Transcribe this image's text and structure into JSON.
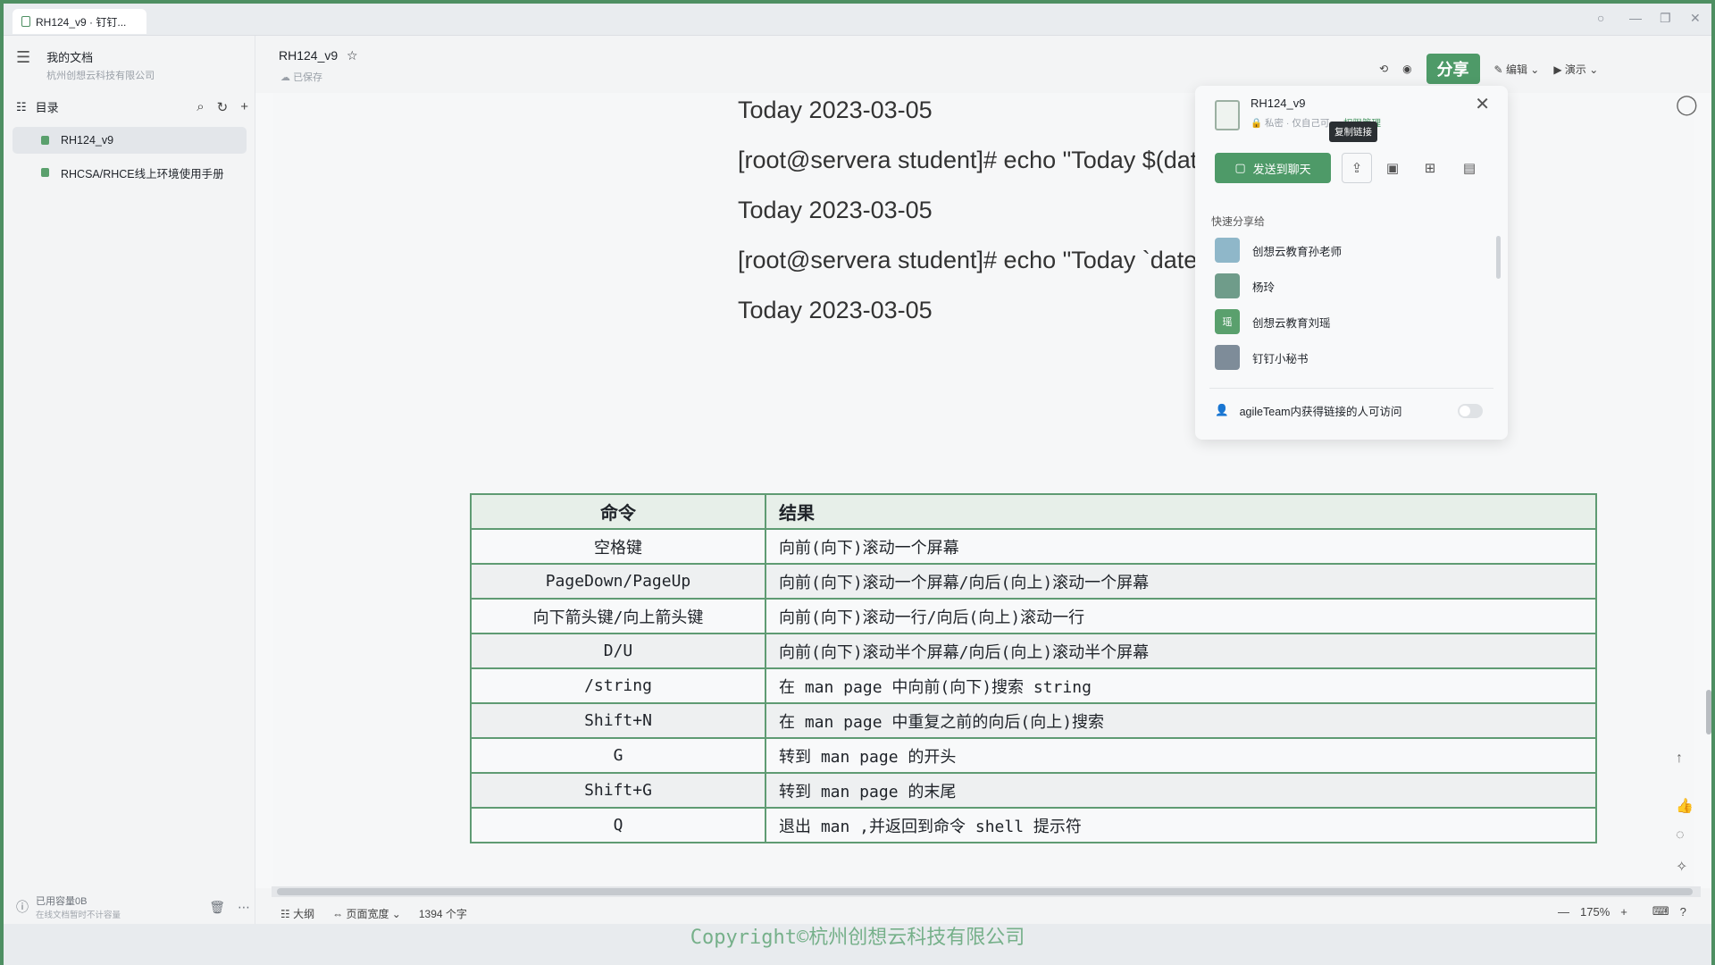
{
  "window": {
    "tab_title": "RH124_v9 · 钉钉..."
  },
  "sidebar": {
    "workspace_title": "我的文档",
    "workspace_org": "杭州创想云科技有限公司",
    "toc_label": "目录",
    "items": [
      {
        "label": "RH124_v9"
      },
      {
        "label": "RHCSA/RHCE线上环境使用手册"
      }
    ],
    "storage_label": "已用容量0B",
    "storage_note": "在线文档暂时不计容量"
  },
  "doc": {
    "title": "RH124_v9",
    "saved_status": "已保存",
    "lines": [
      "Today 2023-03-05",
      "[root@servera student]# echo \"Today $(date +%F)\"",
      "Today 2023-03-05",
      "[root@servera student]# echo \"Today `date +%F`\"",
      "Today 2023-03-05"
    ],
    "table": {
      "headers": [
        "命令",
        "结果"
      ],
      "rows": [
        [
          "空格键",
          "向前(向下)滚动一个屏幕"
        ],
        [
          "PageDown/PageUp",
          "向前(向下)滚动一个屏幕/向后(向上)滚动一个屏幕"
        ],
        [
          "向下箭头键/向上箭头键",
          "向前(向下)滚动一行/向后(向上)滚动一行"
        ],
        [
          "D/U",
          "向前(向下)滚动半个屏幕/向后(向上)滚动半个屏幕"
        ],
        [
          "/string",
          "在 man page 中向前(向下)搜索 string"
        ],
        [
          "Shift+N",
          "在 man page 中重复之前的向后(向上)搜索"
        ],
        [
          "G",
          "转到 man page 的开头"
        ],
        [
          "Shift+G",
          "转到 man page 的末尾"
        ],
        [
          "Q",
          "退出 man ,并返回到命令 shell 提示符"
        ]
      ]
    }
  },
  "toolbar": {
    "share_label": "分享",
    "edit_label": "编辑",
    "present_label": "演示"
  },
  "share_popup": {
    "doc_name": "RH124_v9",
    "privacy": "私密 · 仅自己可...",
    "permission_link": "权限管理",
    "tooltip": "复制链接",
    "send_button": "发送到聊天",
    "quick_share_label": "快速分享给",
    "contacts": [
      {
        "name": "创想云教育孙老师",
        "avatar_color": "#8fb7c9"
      },
      {
        "name": "杨玲",
        "avatar_color": "#6f9c8a"
      },
      {
        "name": "创想云教育刘瑶",
        "avatar_color": "#5aa06d",
        "initial": "瑶"
      },
      {
        "name": "钉钉小秘书",
        "avatar_color": "#7e8c99"
      }
    ],
    "access_text": "agileTeam内获得链接的人可访问"
  },
  "status_bar": {
    "outline": "大纲",
    "page_width": "页面宽度",
    "word_count": "1394 个字",
    "zoom": "175%"
  },
  "watermark": "Copyright©杭州创想云科技有限公司"
}
